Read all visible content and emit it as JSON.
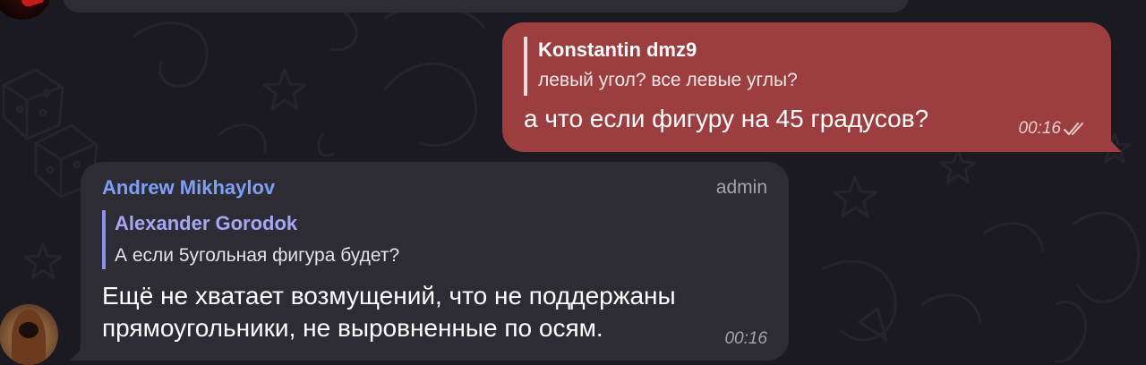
{
  "messages": {
    "outgoing": {
      "reply_to": {
        "name": "Konstantin dmz9",
        "text": "левый угол? все левые углы?"
      },
      "text": "а что если фигуру на 45 градусов?",
      "time": "00:16",
      "status_icon": "double-check-icon"
    },
    "incoming": {
      "sender": "Andrew Mikhaylov",
      "role": "admin",
      "reply_to": {
        "name": "Alexander Gorodok",
        "text": "А если 5угольная фигура будет?"
      },
      "text_lines": [
        "Ещё не хватает возмущений, что не поддержаны",
        "прямоугольники, не выровненные по осям."
      ],
      "time": "00:16"
    }
  },
  "colors": {
    "background": "#1b1a22",
    "incoming_bubble": "#2d2c35",
    "outgoing_bubble": "#9c3d3f",
    "sender_name": "#7d9ff5",
    "reply_name": "#a5a7f5"
  }
}
